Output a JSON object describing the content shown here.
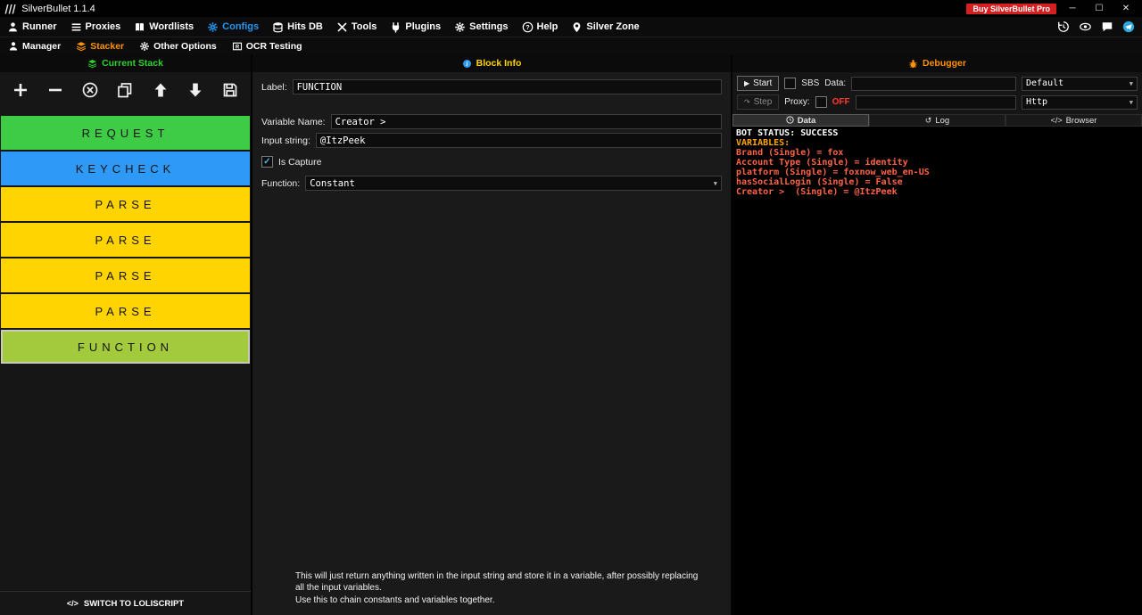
{
  "icons": {
    "logo": "|||",
    "minimize": "─",
    "maximize": "☐",
    "close": "✕",
    "chevron_down": "▼",
    "check": "✓",
    "play": "▶",
    "step_arrow": "↷",
    "code": "</>",
    "log_tab": "↺"
  },
  "titlebar": {
    "title": "SilverBullet 1.1.4",
    "buy_button": "Buy SilverBullet Pro",
    "buy_button_color": "#d42020"
  },
  "menubar": {
    "items": [
      {
        "label": "Runner",
        "icon": "runner-icon"
      },
      {
        "label": "Proxies",
        "icon": "proxies-icon"
      },
      {
        "label": "Wordlists",
        "icon": "wordlists-icon"
      },
      {
        "label": "Configs",
        "icon": "configs-icon",
        "color": "#2196f3"
      },
      {
        "label": "Hits DB",
        "icon": "hits-db-icon"
      },
      {
        "label": "Tools",
        "icon": "tools-icon"
      },
      {
        "label": "Plugins",
        "icon": "plugins-icon"
      },
      {
        "label": "Settings",
        "icon": "settings-icon"
      },
      {
        "label": "Help",
        "icon": "help-icon"
      },
      {
        "label": "Silver Zone",
        "icon": "silver-zone-icon"
      }
    ],
    "tray_icons": [
      "history-icon",
      "eye-icon",
      "chat-icon",
      "telegram-icon"
    ]
  },
  "submenu": {
    "items": [
      {
        "label": "Manager",
        "icon": "manager-icon"
      },
      {
        "label": "Stacker",
        "icon": "stacker-icon",
        "color": "#ff9100"
      },
      {
        "label": "Other Options",
        "icon": "other-options-icon"
      },
      {
        "label": "OCR Testing",
        "icon": "ocr-testing-icon"
      }
    ]
  },
  "stack_panel": {
    "header": "Current Stack",
    "header_color": "#2fd32f",
    "toolbar": [
      {
        "name": "add"
      },
      {
        "name": "remove"
      },
      {
        "name": "clear"
      },
      {
        "name": "clone"
      },
      {
        "name": "move-up"
      },
      {
        "name": "move-down"
      },
      {
        "name": "save"
      }
    ],
    "blocks": [
      {
        "label": "REQUEST",
        "color": "#3ecb46",
        "selected": false
      },
      {
        "label": "KEYCHECK",
        "color": "#2f99f7",
        "selected": false
      },
      {
        "label": "PARSE",
        "color": "#ffd400",
        "selected": false
      },
      {
        "label": "PARSE",
        "color": "#ffd400",
        "selected": false
      },
      {
        "label": "PARSE",
        "color": "#ffd400",
        "selected": false
      },
      {
        "label": "PARSE",
        "color": "#ffd400",
        "selected": false
      },
      {
        "label": "FUNCTION",
        "color": "#a3c93d",
        "selected": true
      }
    ],
    "switch_button": "SWITCH TO LOLISCRIPT"
  },
  "block_info": {
    "header": "Block Info",
    "header_color": "#ffd400",
    "label_field": {
      "label": "Label:",
      "value": "FUNCTION"
    },
    "variable_name": {
      "label": "Variable Name:",
      "value": "Creator >"
    },
    "input_string": {
      "label": "Input string:",
      "value": "@ItzPeek"
    },
    "is_capture": {
      "label": "Is Capture",
      "checked": true
    },
    "function_field": {
      "label": "Function:",
      "value": "Constant"
    },
    "help_lines": [
      "This will just return anything written in the input string and store it in a variable, after possibly replacing all the input variables.",
      "Use this to chain constants and variables together."
    ]
  },
  "debugger": {
    "header": "Debugger",
    "header_color": "#ff9100",
    "start_button": "Start",
    "sbs_label": "SBS",
    "sbs_checked": false,
    "data_label": "Data:",
    "data_value": "",
    "wordlist_type": "Default",
    "step_button": "Step",
    "proxy_label": "Proxy:",
    "proxy_checked": false,
    "proxy_off": "OFF",
    "proxy_off_color": "#ff3b30",
    "proxy_value": "",
    "proxy_type": "Http",
    "tabs": [
      {
        "label": "Data",
        "active": true
      },
      {
        "label": "Log",
        "active": false
      },
      {
        "label": "Browser",
        "active": false
      }
    ],
    "log": [
      {
        "text": "BOT STATUS: SUCCESS",
        "color": "#ffffff"
      },
      {
        "text": "VARIABLES:",
        "color": "#ffa500"
      },
      {
        "text": "Brand (Single) = fox",
        "color": "#ff6347"
      },
      {
        "text": "Account Type (Single) = identity",
        "color": "#ff6347"
      },
      {
        "text": "platform (Single) = foxnow_web_en-US",
        "color": "#ff6347"
      },
      {
        "text": "hasSocialLogin (Single) = False",
        "color": "#ff6347"
      },
      {
        "text": "Creator >  (Single) = @ItzPeek",
        "color": "#ff6347"
      }
    ]
  }
}
